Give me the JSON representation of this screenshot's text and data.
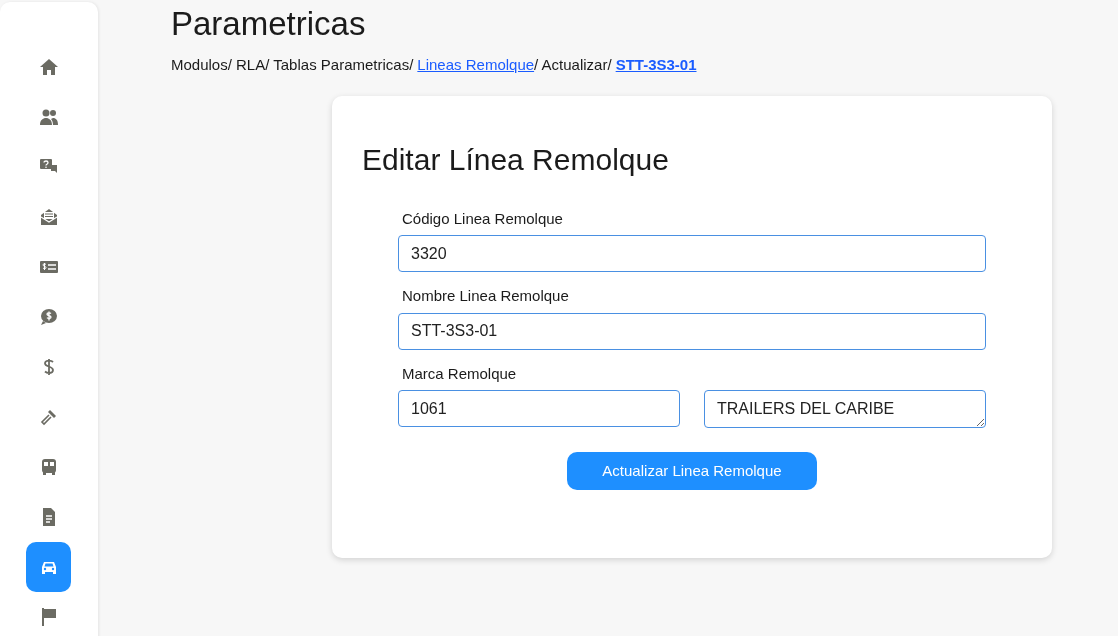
{
  "sidebar": {
    "items": [
      {
        "kind": "home",
        "selected": false
      },
      {
        "kind": "users",
        "selected": false
      },
      {
        "kind": "question-chat",
        "selected": false
      },
      {
        "kind": "envelope",
        "selected": false
      },
      {
        "kind": "money-card",
        "selected": false
      },
      {
        "kind": "dollar-chat",
        "selected": false
      },
      {
        "kind": "dollar",
        "selected": false
      },
      {
        "kind": "hammer",
        "selected": false
      },
      {
        "kind": "bus",
        "selected": false
      },
      {
        "kind": "document",
        "selected": false
      },
      {
        "kind": "car",
        "selected": true
      },
      {
        "kind": "flag",
        "selected": false
      }
    ]
  },
  "page_title": "Parametricas",
  "breadcrumb": [
    {
      "kind": "text",
      "label": "Modulos/ RLA/ Tablas Parametricas/"
    },
    {
      "kind": "link",
      "label": "Lineas Remolque"
    },
    {
      "kind": "text",
      "label": "/ Actualizar/"
    },
    {
      "kind": "current",
      "label": "STT-3S3-01"
    }
  ],
  "form": {
    "title": "Editar Línea Remolque",
    "fields": [
      {
        "label": "Código Linea Remolque",
        "inputs": [
          {
            "kind": "input",
            "value": "3320"
          }
        ]
      },
      {
        "label": "Nombre Linea Remolque",
        "inputs": [
          {
            "kind": "input",
            "value": "STT-3S3-01"
          }
        ]
      },
      {
        "label": "Marca Remolque",
        "inputs": [
          {
            "kind": "input",
            "value": "1061"
          },
          {
            "kind": "textarea",
            "value": "TRAILERS DEL CARIBE"
          }
        ]
      }
    ],
    "submit": "Actualizar Linea Remolque"
  }
}
